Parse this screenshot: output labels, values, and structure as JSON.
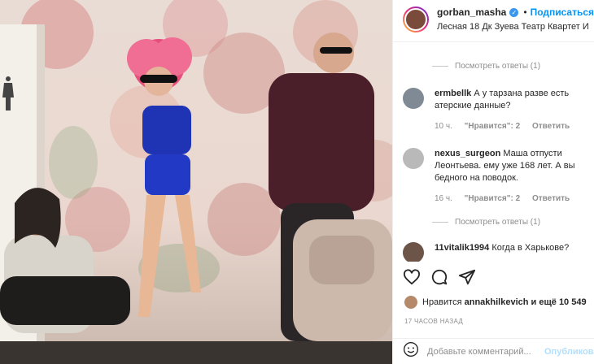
{
  "header": {
    "username": "gorban_masha",
    "follow_label": "Подписаться",
    "location": "Лесная 18 Дк Зуева Театр Квартет И"
  },
  "comments": {
    "view_replies_1": "Посмотреть ответы (1)",
    "items": [
      {
        "username": "ermbellk",
        "text": "А у тарзана разве есть атерские данные?",
        "time": "10 ч.",
        "likes": "\"Нравится\": 2",
        "reply": "Ответить"
      },
      {
        "username": "nexus_surgeon",
        "text": "Маша отпусти Леонтьева. ему уже 168 лет. А вы бедного на поводок.",
        "time": "16 ч.",
        "likes": "\"Нравится\": 2",
        "reply": "Ответить"
      },
      {
        "username": "11vitalik1994",
        "text": "Когда в Харькове?"
      }
    ],
    "view_replies_2": "Посмотреть ответы (1)"
  },
  "likes": {
    "prefix": "Нравится",
    "user": "annakhilkevich",
    "suffix": "и ещё 10 549"
  },
  "timestamp": "17 ЧАСОВ НАЗАД",
  "add_comment": {
    "placeholder": "Добавьте комментарий...",
    "publish_label": "Опубликовать"
  },
  "colors": {
    "accent": "#0095f6",
    "verified": "#3897f0",
    "muted": "#8e8e8e"
  },
  "icons": [
    "heart-icon",
    "comment-icon",
    "share-icon",
    "emoji-icon",
    "verified-icon"
  ]
}
